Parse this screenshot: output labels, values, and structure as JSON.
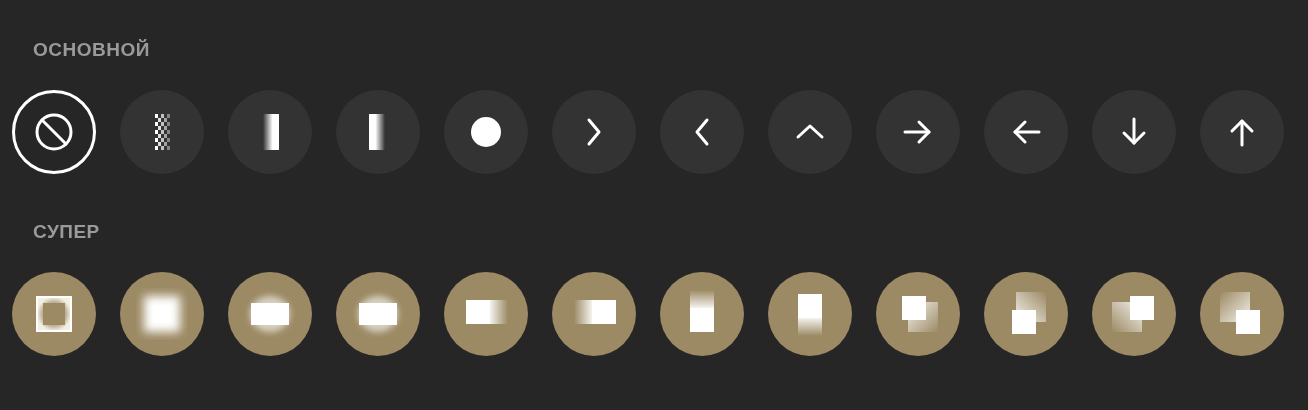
{
  "sections": [
    {
      "title": "ОСНОВНОЙ",
      "kind": "basic",
      "items": [
        {
          "kind": "none",
          "selected": true
        },
        {
          "kind": "checker",
          "selected": false
        },
        {
          "kind": "fade-left",
          "selected": false
        },
        {
          "kind": "fade-right",
          "selected": false
        },
        {
          "kind": "dot",
          "selected": false
        },
        {
          "kind": "chevron-right",
          "selected": false
        },
        {
          "kind": "chevron-left",
          "selected": false
        },
        {
          "kind": "chevron-up",
          "selected": false
        },
        {
          "kind": "arrow-right",
          "selected": false
        },
        {
          "kind": "arrow-left",
          "selected": false
        },
        {
          "kind": "arrow-down",
          "selected": false
        },
        {
          "kind": "arrow-up",
          "selected": false
        }
      ]
    },
    {
      "title": "СУПЕР",
      "kind": "super",
      "items": [
        {
          "kind": "square-outline",
          "selected": false
        },
        {
          "kind": "square-glow",
          "selected": false
        },
        {
          "kind": "rect-burst",
          "selected": false
        },
        {
          "kind": "rect-burst",
          "selected": false
        },
        {
          "kind": "trail-right",
          "selected": false
        },
        {
          "kind": "trail-left",
          "selected": false
        },
        {
          "kind": "trail-up",
          "selected": false
        },
        {
          "kind": "trail-down",
          "selected": false
        },
        {
          "kind": "trail-se",
          "selected": false
        },
        {
          "kind": "trail-ne",
          "selected": false
        },
        {
          "kind": "trail-sw",
          "selected": false
        },
        {
          "kind": "trail-nw",
          "selected": false
        }
      ]
    }
  ]
}
